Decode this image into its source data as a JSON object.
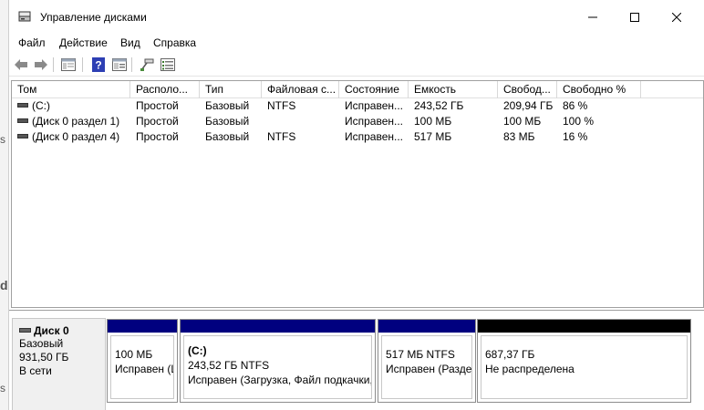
{
  "window": {
    "title": "Управление дисками"
  },
  "background": {
    "fragments": [
      "s",
      "d",
      "s"
    ]
  },
  "menu": [
    "Файл",
    "Действие",
    "Вид",
    "Справка"
  ],
  "toolbar_icons": [
    "back-arrow-icon",
    "forward-arrow-icon",
    "console-tree-icon",
    "help-icon",
    "properties-icon",
    "connect-icon",
    "details-list-icon"
  ],
  "list": {
    "columns": [
      "Том",
      "Располо...",
      "Тип",
      "Файловая с...",
      "Состояние",
      "Емкость",
      "Свобод...",
      "Свободно %"
    ],
    "rows": [
      [
        "(C:)",
        "Простой",
        "Базовый",
        "NTFS",
        "Исправен...",
        "243,52 ГБ",
        "209,94 ГБ",
        "86 %"
      ],
      [
        "(Диск 0 раздел 1)",
        "Простой",
        "Базовый",
        "",
        "Исправен...",
        "100 МБ",
        "100 МБ",
        "100 %"
      ],
      [
        "(Диск 0 раздел 4)",
        "Простой",
        "Базовый",
        "NTFS",
        "Исправен...",
        "517 МБ",
        "83 МБ",
        "16 %"
      ]
    ]
  },
  "disk": {
    "name": "Диск 0",
    "type": "Базовый",
    "size": "931,50 ГБ",
    "status": "В сети"
  },
  "partitions": [
    {
      "title": "",
      "size": "100 МБ",
      "state": "Исправен (Ш"
    },
    {
      "title": "(C:)",
      "size": "243,52 ГБ NTFS",
      "state": "Исправен (Загрузка, Файл подкачки,"
    },
    {
      "title": "",
      "size": "517 МБ NTFS",
      "state": "Исправен (Разде."
    },
    {
      "title": "",
      "size": "687,37 ГБ",
      "state": "Не распределена"
    }
  ],
  "colors": {
    "primary_partition": "#00007f",
    "unallocated": "#000000"
  }
}
